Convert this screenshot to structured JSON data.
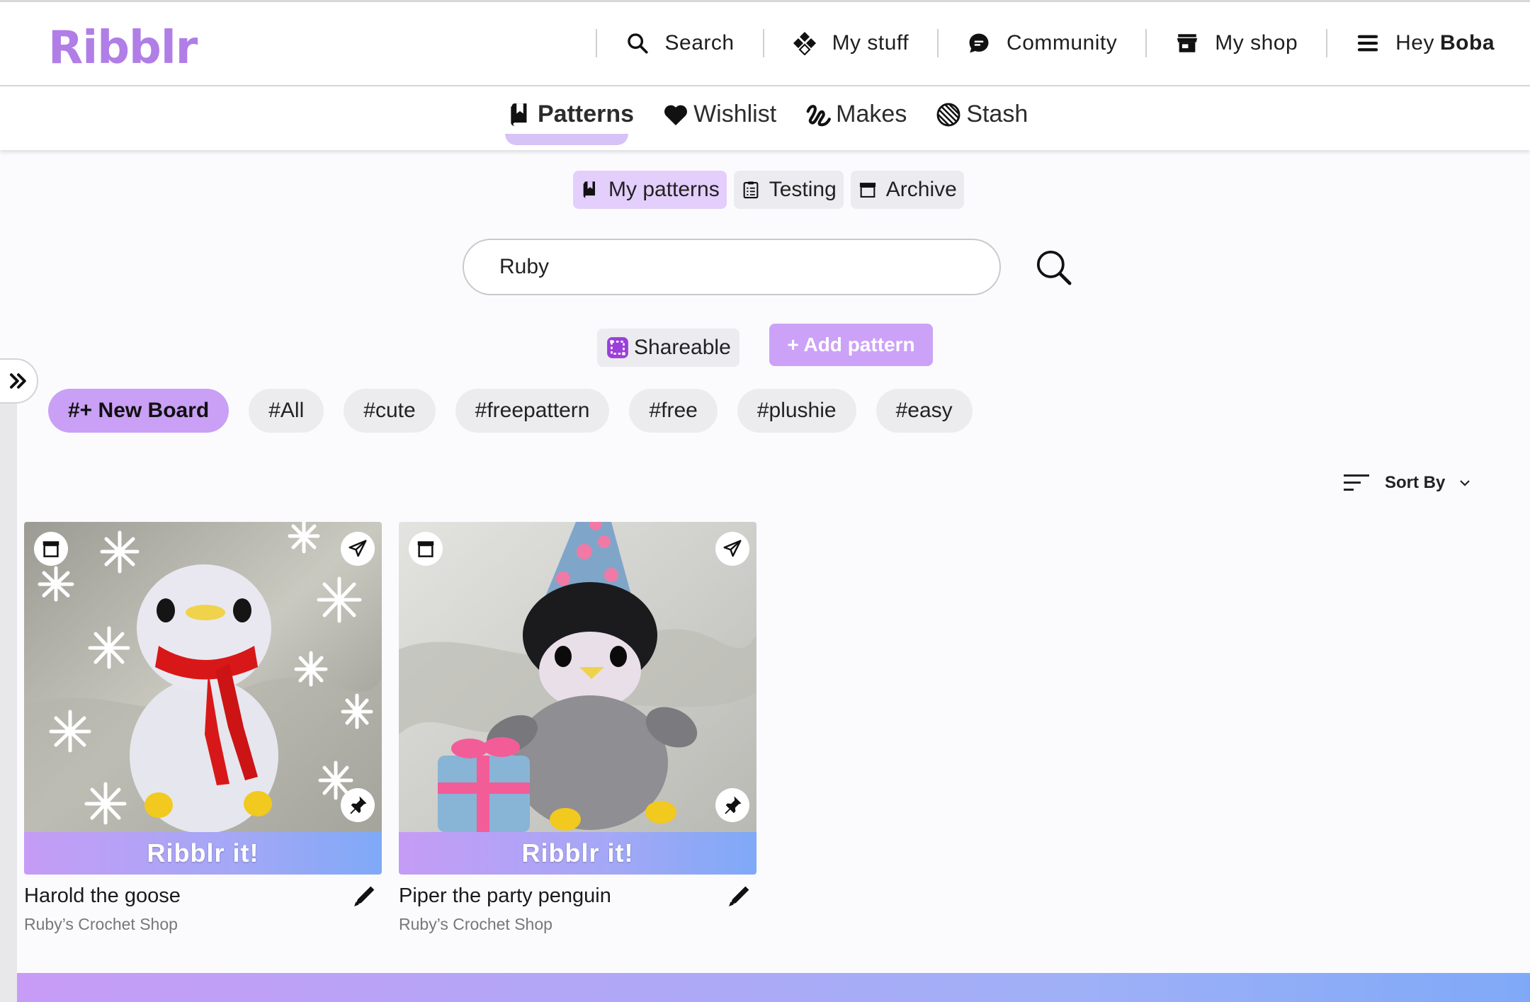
{
  "header": {
    "logo": "Ribblr",
    "nav": {
      "search": "Search",
      "my_stuff": "My stuff",
      "community": "Community",
      "my_shop": "My shop",
      "greeting": "Hey",
      "user_name": "Boba"
    }
  },
  "tabs": [
    {
      "label": "Patterns",
      "icon": "bookmark-icon",
      "active": true
    },
    {
      "label": "Wishlist",
      "icon": "heart-icon"
    },
    {
      "label": "Makes",
      "icon": "yarn-squiggle-icon"
    },
    {
      "label": "Stash",
      "icon": "yarn-ball-icon"
    }
  ],
  "subtabs": [
    {
      "label": "My patterns",
      "icon": "bookmark-icon",
      "active": true
    },
    {
      "label": "Testing",
      "icon": "clipboard-icon"
    },
    {
      "label": "Archive",
      "icon": "archive-box-icon"
    }
  ],
  "search": {
    "value": "Ruby",
    "placeholder": ""
  },
  "actions": {
    "shareable": "Shareable",
    "add_pattern": "+ Add pattern"
  },
  "chips": [
    "#+ New Board",
    "#All",
    "#cute",
    "#freepattern",
    "#free",
    "#plushie",
    "#easy"
  ],
  "sort": {
    "label": "Sort By"
  },
  "cards": [
    {
      "title": "Harold the goose",
      "shop": "Ruby’s Crochet Shop",
      "cta": "Ribblr it!"
    },
    {
      "title": "Piper the party penguin",
      "shop": "Ruby’s Crochet Shop",
      "cta": "Ribblr it!"
    }
  ],
  "colors": {
    "brand": "#b07ee6",
    "accent": "#c9a0f5",
    "gradient_end": "#7fa9f7"
  }
}
